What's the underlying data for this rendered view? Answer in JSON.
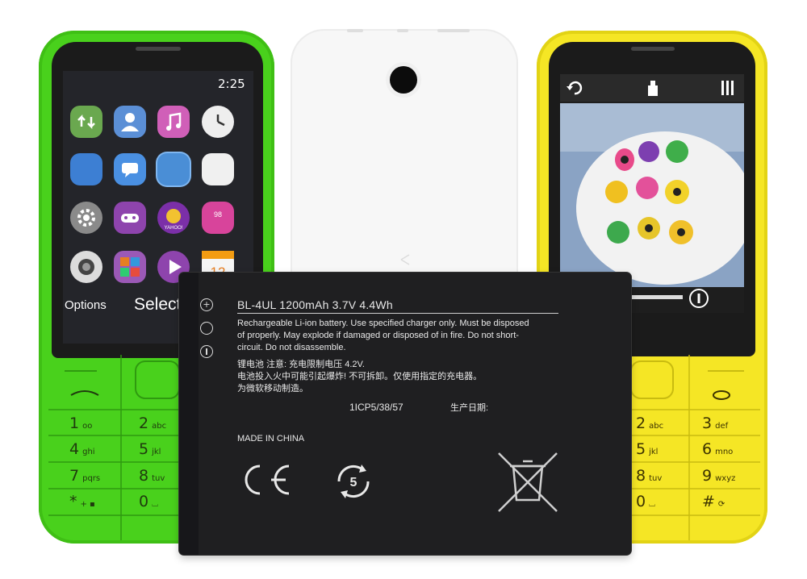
{
  "green_phone": {
    "time": "2:25",
    "softkey_left": "Options",
    "softkey_right": "Select",
    "app_icons": [
      "sync-icon",
      "contacts-icon",
      "music-icon",
      "clock-icon",
      "blank-app-icon",
      "messaging-icon",
      "blank-app-icon",
      "blank-app-icon",
      "settings-icon",
      "games-icon",
      "yahoo-icon",
      "app-98-icon",
      "camera-icon",
      "gallery-icon",
      "video-player-icon",
      "calendar-icon"
    ],
    "app_badge_98": "98",
    "app_yahoo_label": "YAHOO!",
    "calendar_day": "12",
    "keys": [
      {
        "digit": "1",
        "letters": "oo"
      },
      {
        "digit": "2",
        "letters": "abc"
      },
      {
        "digit": "4",
        "letters": "ghi"
      },
      {
        "digit": "5",
        "letters": "jkl"
      },
      {
        "digit": "7",
        "letters": "pqrs"
      },
      {
        "digit": "8",
        "letters": "tuv"
      },
      {
        "digit": "*",
        "letters": "+ ▪"
      },
      {
        "digit": "0",
        "letters": "⌴"
      }
    ],
    "color": "#49d11c"
  },
  "yellow_phone": {
    "keys": [
      {
        "digit": "2",
        "letters": "abc"
      },
      {
        "digit": "3",
        "letters": "def"
      },
      {
        "digit": "5",
        "letters": "jkl"
      },
      {
        "digit": "6",
        "letters": "mno"
      },
      {
        "digit": "8",
        "letters": "tuv"
      },
      {
        "digit": "9",
        "letters": "wxyz"
      },
      {
        "digit": "0",
        "letters": "⌴"
      },
      {
        "digit": "#",
        "letters": "⟳"
      }
    ],
    "toolbar_icons": [
      "back-arrow-icon",
      "share-icon",
      "menu-icon"
    ],
    "color": "#f5e625"
  },
  "white_phone": {
    "color": "#f7f7f7"
  },
  "battery": {
    "model_line": "BL-4UL 1200mAh 3.7V 4.4Wh",
    "warning_en": [
      "Rechargeable Li-ion battery. Use specified charger only. Must be disposed",
      "of properly. May explode if damaged or disposed of in fire. Do not short-",
      "circuit. Do not disassemble."
    ],
    "warning_cn": [
      "锂电池  注意: 充电限制电压 4.2V.",
      "电池投入火中可能引起爆炸! 不可拆卸。仅使用指定的充电器。",
      "为微软移动制造。"
    ],
    "serial": "1ICP5/38/57",
    "date_label": "生产日期:",
    "made_in": "MADE IN CHINA",
    "ce_mark": "CE",
    "recycle_number": "5",
    "terminals": [
      "+",
      "",
      ""
    ],
    "color": "#1f1f21"
  }
}
